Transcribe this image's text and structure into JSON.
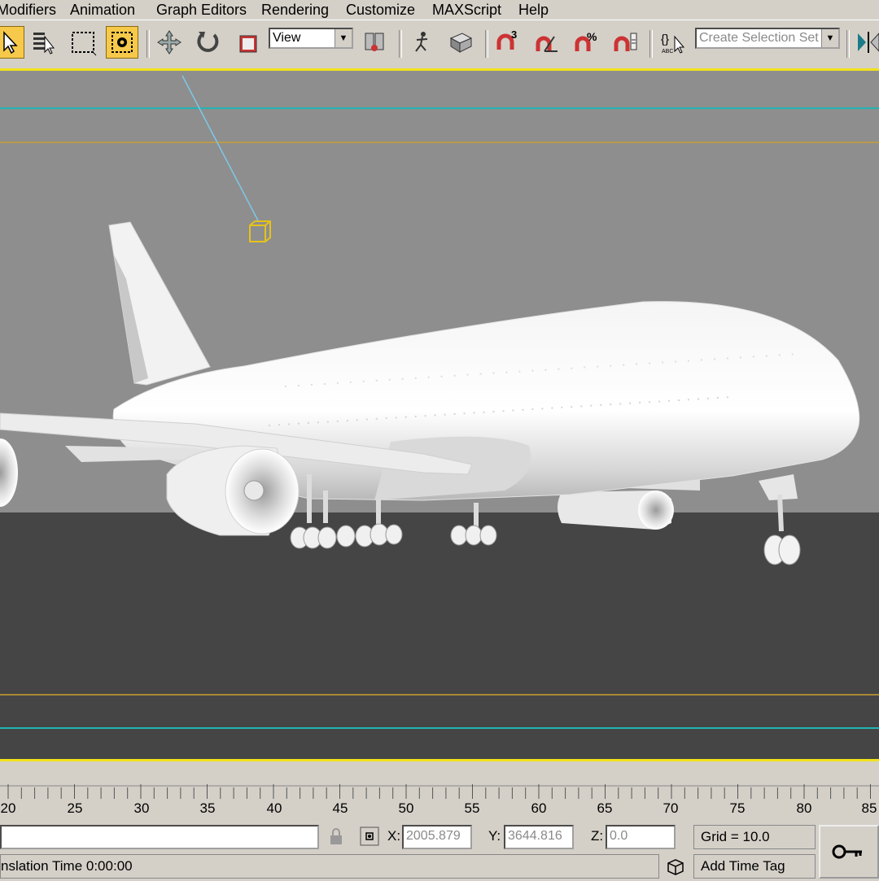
{
  "menubar": {
    "items": [
      "Modifiers",
      "Animation",
      "Graph Editors",
      "Rendering",
      "Customize",
      "MAXScript",
      "Help"
    ]
  },
  "toolbar": {
    "buttons": [
      "select-object",
      "select-by-name",
      "rectangular-selection-region",
      "window-crossing",
      "select-and-move",
      "select-and-rotate",
      "select-and-uniform-scale",
      "use-pivot-point-center",
      "select-and-manipulate",
      "mirror",
      "align",
      "snaps-toggle-3d",
      "angle-snap-toggle",
      "percent-snap-toggle",
      "spinner-snap-toggle",
      "edit-named-selection-sets",
      "named-selection-sets-dropdown",
      "mirror-tool"
    ],
    "active": [
      "select-object",
      "window-crossing"
    ],
    "reference_coord_system": "View",
    "snap_label": "3",
    "percent_label": "%",
    "named_selection_placeholder": "Create Selection Set"
  },
  "viewport": {
    "scene_object": "Airbus A380 model",
    "colors": {
      "background": "#8e8e8e",
      "ground": "#454545",
      "frame_border": "#f2e21a",
      "safe_frame_orange": "#c9a030",
      "safe_frame_cyan": "#1fb5b5",
      "light_icon": "#e6c21a"
    }
  },
  "timeline": {
    "ticks": [
      "20",
      "25",
      "30",
      "35",
      "40",
      "45",
      "50",
      "55",
      "60",
      "65",
      "70",
      "75",
      "80",
      "85"
    ]
  },
  "statusbar": {
    "prompt": "nslation Time  0:00:00",
    "x_label": "X:",
    "x_value": "2005.879",
    "y_label": "Y:",
    "y_value": "3644.816",
    "z_label": "Z:",
    "z_value": "0.0",
    "grid": "Grid = 10.0",
    "add_time_tag": "Add Time Tag"
  }
}
